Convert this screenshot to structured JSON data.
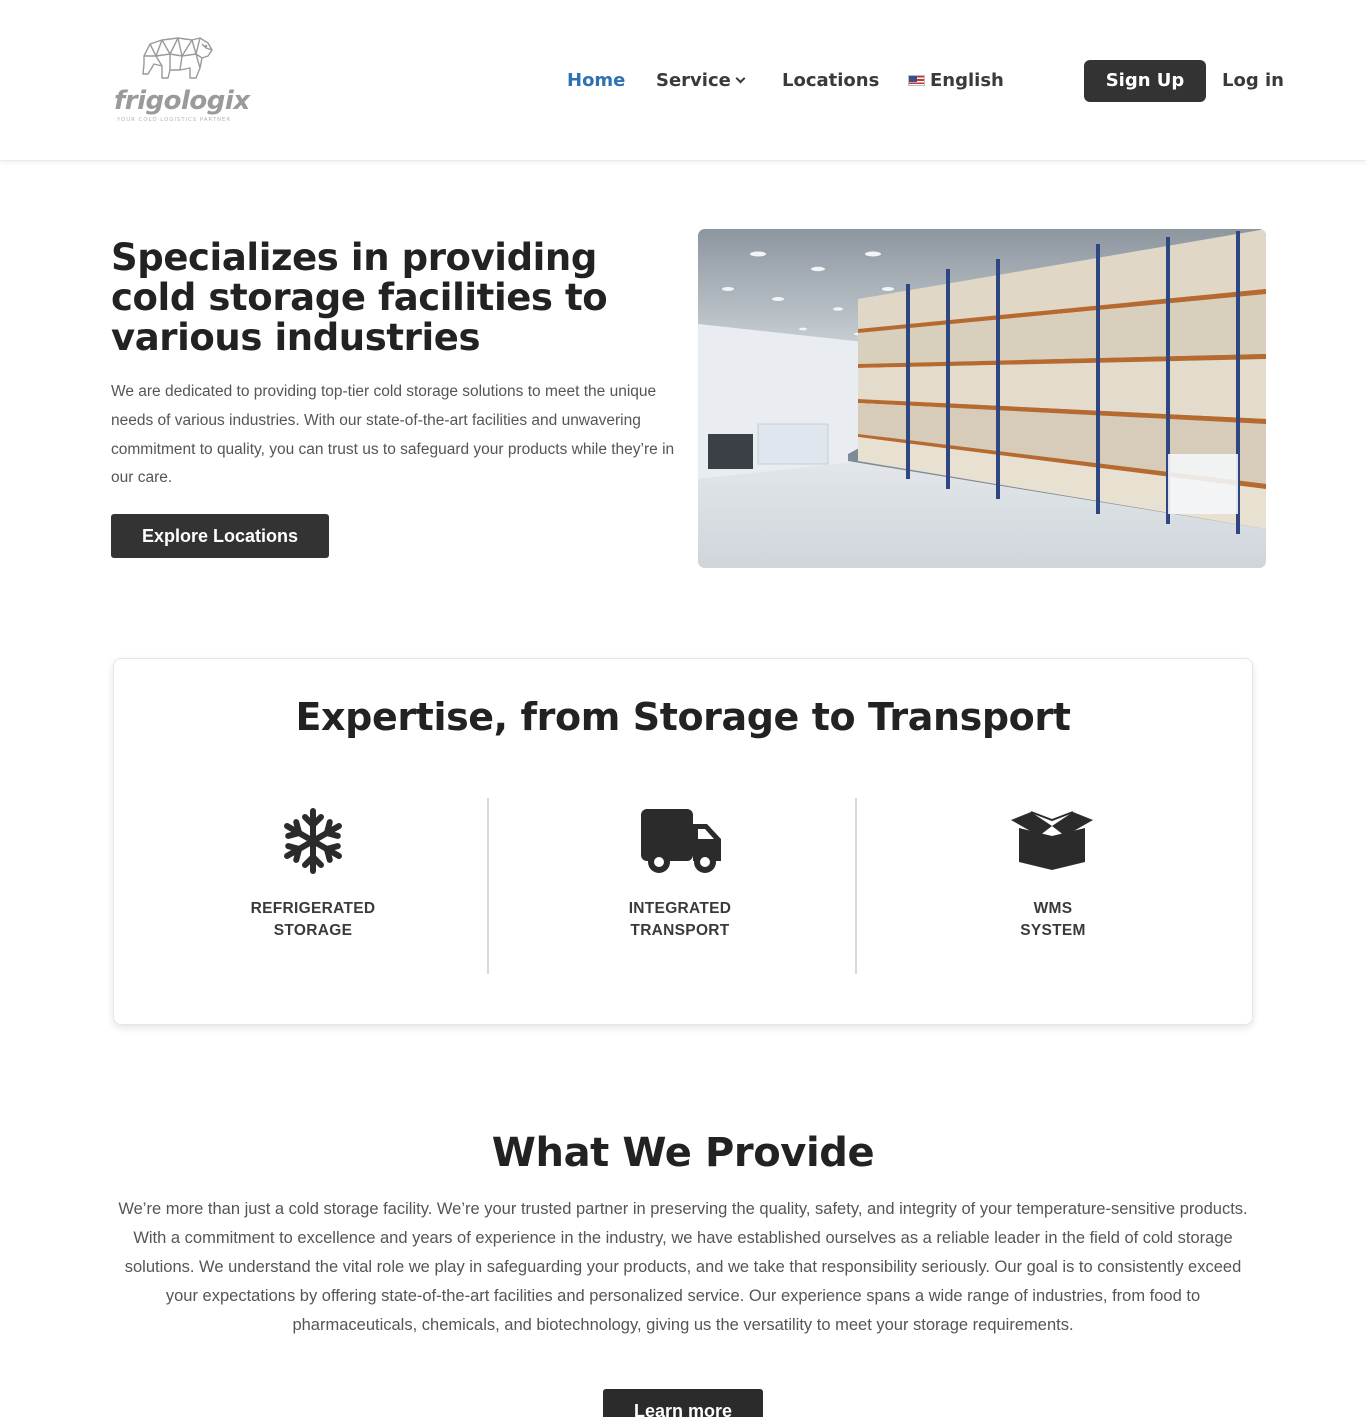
{
  "logo": {
    "wordmark": "frigologix",
    "tagline": "YOUR COLD LOGISTICS PARTNER"
  },
  "nav": {
    "home": "Home",
    "service": "Service",
    "locations": "Locations",
    "language": "English",
    "signup": "Sign Up",
    "login": "Log in"
  },
  "hero": {
    "title": "Specializes in providing cold storage facilities to various industries",
    "text": "We are dedicated to providing top-tier cold storage solutions to meet the unique needs of various industries. With our state-of-the-art facilities and unwavering commitment to quality, you can trust us to safeguard your products while they’re in our care.",
    "button": "Explore Locations"
  },
  "expertise": {
    "title": "Expertise, from Storage to Transport",
    "features": [
      {
        "icon": "snowflake-icon",
        "line1": "REFRIGERATED",
        "line2": "STORAGE"
      },
      {
        "icon": "truck-icon",
        "line1": "INTEGRATED",
        "line2": "TRANSPORT"
      },
      {
        "icon": "box-icon",
        "line1": "WMS",
        "line2": "SYSTEM"
      }
    ]
  },
  "provide": {
    "title": "What We Provide",
    "text": "We’re more than just a cold storage facility. We’re your trusted partner in preserving the quality, safety, and integrity of your temperature-sensitive products. With a commitment to excellence and years of experience in the industry, we have established ourselves as a reliable leader in the field of cold storage solutions. We understand the vital role we play in safeguarding your products, and we take that responsibility seriously. Our goal is to consistently exceed your expectations by offering state-of-the-art facilities and personalized service. Our experience spans a wide range of industries, from food to pharmaceuticals, chemicals, and biotechnology, giving us the versatility to meet your storage requirements.",
    "button": "Learn more"
  },
  "colors": {
    "nav_active": "#2f72b1",
    "button_dark": "#333333",
    "heading": "#222222",
    "body_text": "#555555"
  }
}
